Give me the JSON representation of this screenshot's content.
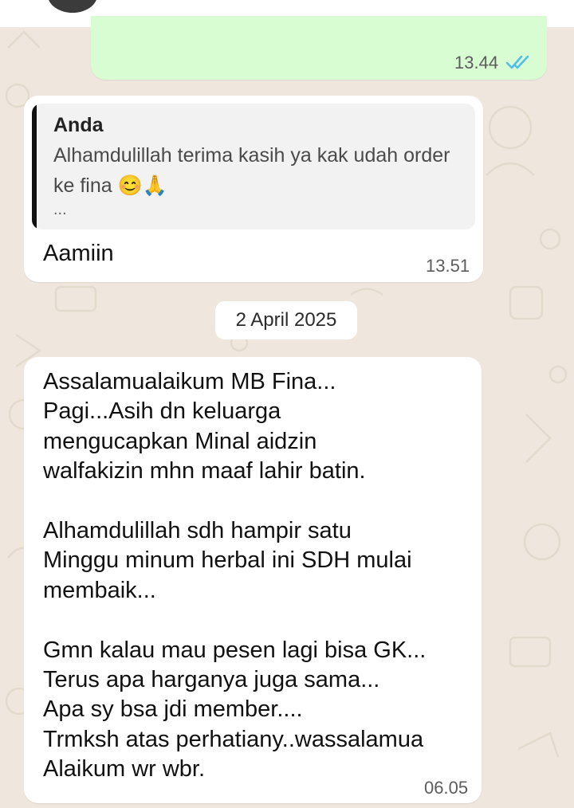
{
  "outgoing_message": {
    "time": "13.44"
  },
  "reply_message": {
    "quote_author": "Anda",
    "quote_text": "Alhamdulillah terima kasih ya kak udah order ke fina 😊🙏",
    "quote_more": "...",
    "text": "Aamiin",
    "time": "13.51"
  },
  "date_divider": "2 April 2025",
  "long_message": {
    "text": "Assalamualaikum MB Fina...\nPagi...Asih dn keluarga\nmengucapkan Minal aidzin\nwalfakizin mhn maaf lahir batin.\n\nAlhamdulillah sdh hampir satu\nMinggu minum herbal ini SDH mulai\nmembaik...\n\nGmn kalau mau pesen lagi bisa GK...\nTerus apa harganya juga sama...\nApa sy bsa jdi member....\nTrmksh atas perhatiany..wassalamua\nAlaikum wr wbr.",
    "time": "06.05"
  },
  "colors": {
    "chat_background": "#efe7dd",
    "outgoing_bubble": "#d9fdd3",
    "incoming_bubble": "#ffffff",
    "read_ticks": "#53bdeb"
  },
  "icons": {
    "read_receipt": "double-check-icon"
  }
}
